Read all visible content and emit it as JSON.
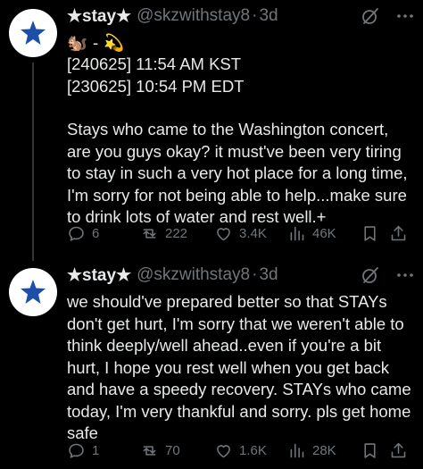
{
  "colors": {
    "background": "#000000",
    "text": "#e7e9ea",
    "muted": "#71767b",
    "avatar_star": "#1d4fa8",
    "avatar_bg": "#ffffff"
  },
  "tweets": [
    {
      "display_name": "★stay★",
      "handle": "@skzwithstay8",
      "separator": "·",
      "age": "3d",
      "emoji_line": [
        "🐿️",
        "-",
        "💫"
      ],
      "date_line_1": "[240625] 11:54 AM KST",
      "date_line_2": "[230625] 10:54 PM EDT",
      "body": "Stays who came to the Washington concert, are you guys okay? it must've been very tiring to stay in such a very hot place for a long time, I'm sorry for not being able to help...make sure to drink lots of water and rest well.+",
      "replies": "6",
      "reposts": "222",
      "likes": "3.4K",
      "views": "46K"
    },
    {
      "display_name": "★stay★",
      "handle": "@skzwithstay8",
      "separator": "·",
      "age": "3d",
      "body": "we should've prepared better so that STAYs don't get hurt, I'm sorry that we weren't able to think deeply/well ahead..even if you're a bit hurt, I hope you rest well when you get back and have a speedy recovery. STAYs who came today, I'm very thankful and sorry. pls get home safe",
      "replies": "1",
      "reposts": "70",
      "likes": "1.6K",
      "views": "28K"
    }
  ],
  "icons": {
    "avatar": "star-avatar-icon",
    "grok": "grok-icon",
    "more": "more-icon",
    "reply": "reply-icon",
    "repost": "repost-icon",
    "like": "heart-icon",
    "views": "views-icon",
    "bookmark": "bookmark-icon",
    "share": "share-icon"
  }
}
